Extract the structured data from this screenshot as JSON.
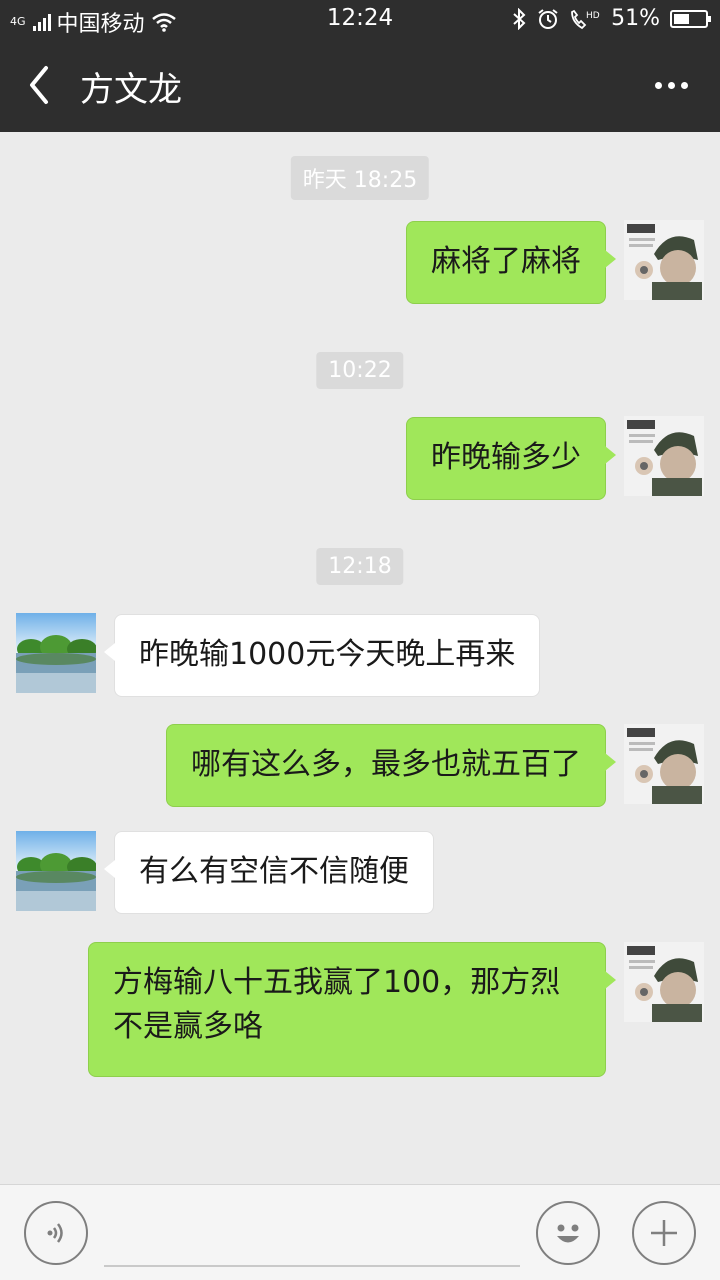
{
  "status_bar": {
    "network": "4G",
    "carrier": "中国移动",
    "time": "12:24",
    "battery": "51%",
    "battery_level": 0.51,
    "icons": [
      "signal-icon",
      "wifi-icon",
      "bluetooth-icon",
      "alarm-icon",
      "hd-call-icon",
      "battery-icon"
    ]
  },
  "header": {
    "title": "方文龙",
    "back_icon": "chevron-left-icon",
    "more_icon": "more-dots-icon"
  },
  "messages": [
    {
      "type": "time",
      "text": "昨天 18:25"
    },
    {
      "type": "message",
      "side": "me",
      "text": "麻将了麻将"
    },
    {
      "type": "time",
      "text": "10:22"
    },
    {
      "type": "message",
      "side": "me",
      "text": "昨晚输多少"
    },
    {
      "type": "time",
      "text": "12:18"
    },
    {
      "type": "message",
      "side": "them",
      "text": "昨晚输1000元今天晚上再来"
    },
    {
      "type": "message",
      "side": "me",
      "text": "哪有这么多，最多也就五百了"
    },
    {
      "type": "message",
      "side": "them",
      "text": "有么有空信不信随便"
    },
    {
      "type": "message",
      "side": "me",
      "text": "方梅输八十五我赢了100，那方烈不是赢多咯"
    }
  ],
  "input_bar": {
    "voice_icon": "voice-icon",
    "emoji_icon": "emoji-icon",
    "add_icon": "plus-icon",
    "input_value": ""
  },
  "colors": {
    "header_bg": "#2e2e2e",
    "chat_bg": "#ebebeb",
    "my_bubble": "#a0e75a",
    "their_bubble": "#ffffff",
    "timestamp_bg": "#dadada"
  }
}
